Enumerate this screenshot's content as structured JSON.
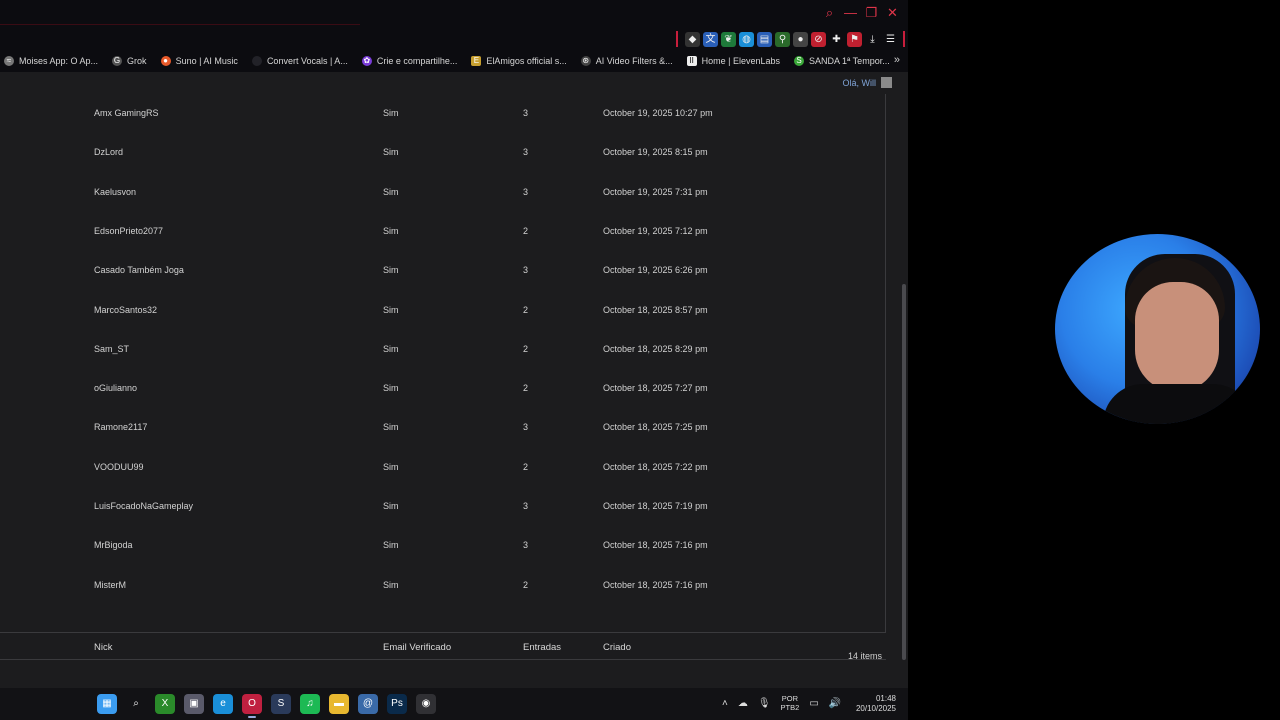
{
  "toolbar": {
    "extensions": [
      "diamond",
      "translate",
      "leaf",
      "globe",
      "docs",
      "bike",
      "lock",
      "block",
      "puzzle",
      "alert",
      "download",
      "menu"
    ]
  },
  "bookmarks": [
    {
      "label": "Moises App: O Ap...",
      "icon": "moises-icon",
      "color": "#777777"
    },
    {
      "label": "Grok",
      "icon": "grok-icon",
      "color": "#555555"
    },
    {
      "label": "Suno | AI Music",
      "icon": "suno-icon",
      "color": "#e85a2a"
    },
    {
      "label": "Convert Vocals | A...",
      "icon": "convert-icon",
      "color": "#222228"
    },
    {
      "label": "Crie e compartilhe...",
      "icon": "crie-icon",
      "color": "#7a3cd8"
    },
    {
      "label": "ElAmigos official s...",
      "icon": "elamigos-icon",
      "color": "#c8a030"
    },
    {
      "label": "AI Video Filters &...",
      "icon": "aivideo-icon",
      "color": "#444444"
    },
    {
      "label": "Home | ElevenLabs",
      "icon": "elevenlabs-icon",
      "color": "#eeeeee"
    },
    {
      "label": "SANDA 1ª Tempor...",
      "icon": "sanda-icon",
      "color": "#3aa838"
    }
  ],
  "header": {
    "greeting": "Olá, Will"
  },
  "table": {
    "columns": {
      "nick": "Nick",
      "email": "Email Verificado",
      "entries": "Entradas",
      "created": "Criado"
    },
    "rows": [
      {
        "nick": "Amx GamingRS",
        "email": "Sim",
        "entries": "3",
        "created": "October 19, 2025 10:27 pm"
      },
      {
        "nick": "DzLord",
        "email": "Sim",
        "entries": "3",
        "created": "October 19, 2025 8:15 pm"
      },
      {
        "nick": "Kaelusvon",
        "email": "Sim",
        "entries": "3",
        "created": "October 19, 2025 7:31 pm"
      },
      {
        "nick": "EdsonPrieto2077",
        "email": "Sim",
        "entries": "2",
        "created": "October 19, 2025 7:12 pm"
      },
      {
        "nick": "Casado Também Joga",
        "email": "Sim",
        "entries": "3",
        "created": "October 19, 2025 6:26 pm"
      },
      {
        "nick": "MarcoSantos32",
        "email": "Sim",
        "entries": "2",
        "created": "October 18, 2025 8:57 pm"
      },
      {
        "nick": "Sam_ST",
        "email": "Sim",
        "entries": "2",
        "created": "October 18, 2025 8:29 pm"
      },
      {
        "nick": "oGiulianno",
        "email": "Sim",
        "entries": "2",
        "created": "October 18, 2025 7:27 pm"
      },
      {
        "nick": "Ramone2117",
        "email": "Sim",
        "entries": "3",
        "created": "October 18, 2025 7:25 pm"
      },
      {
        "nick": "VOODUU99",
        "email": "Sim",
        "entries": "2",
        "created": "October 18, 2025 7:22 pm"
      },
      {
        "nick": "LuisFocadoNaGameplay",
        "email": "Sim",
        "entries": "3",
        "created": "October 18, 2025 7:19 pm"
      },
      {
        "nick": "MrBigoda",
        "email": "Sim",
        "entries": "3",
        "created": "October 18, 2025 7:16 pm"
      },
      {
        "nick": "MisterM",
        "email": "Sim",
        "entries": "2",
        "created": "October 18, 2025 7:16 pm"
      }
    ],
    "items_count": "14 items"
  },
  "taskbar": {
    "apps": [
      {
        "name": "windows-start-icon",
        "glyph": "▦",
        "color": "#3b9cf0"
      },
      {
        "name": "search-icon",
        "glyph": "⌕",
        "color": "transparent"
      },
      {
        "name": "xbox-icon",
        "glyph": "X",
        "color": "#2a8a2a"
      },
      {
        "name": "capture-icon",
        "glyph": "▣",
        "color": "#5a5a6a"
      },
      {
        "name": "edge-icon",
        "glyph": "e",
        "color": "#1a8fd8"
      },
      {
        "name": "opera-icon",
        "glyph": "O",
        "color": "#c02040"
      },
      {
        "name": "steam-icon",
        "glyph": "S",
        "color": "#2a3a5a"
      },
      {
        "name": "spotify-icon",
        "glyph": "♫",
        "color": "#1db954"
      },
      {
        "name": "folder-icon",
        "glyph": "▬",
        "color": "#e8b830"
      },
      {
        "name": "app-shell-icon",
        "glyph": "@",
        "color": "#3a6aa8"
      },
      {
        "name": "photoshop-icon",
        "glyph": "Ps",
        "color": "#0a2a4a"
      },
      {
        "name": "obs-icon",
        "glyph": "◉",
        "color": "#303034"
      }
    ],
    "lang": "POR",
    "lang_sub": "PTB2",
    "time": "01:48",
    "date": "20/10/2025"
  }
}
